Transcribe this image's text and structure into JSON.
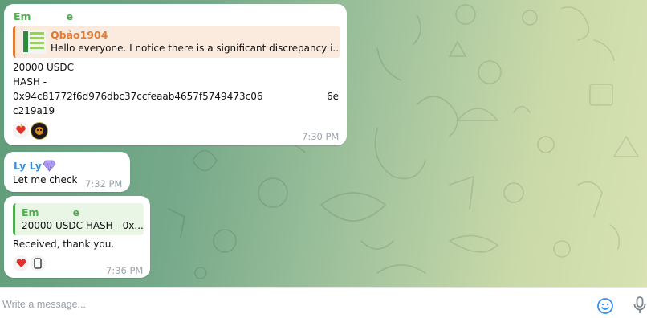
{
  "messages": [
    {
      "sender_prefix": "Em",
      "sender_suffix": "e",
      "reply": {
        "author": "Qbảo1904",
        "text": "Hello everyone. I notice there is a significant discrepancy i..."
      },
      "lines": [
        "20000 USDC",
        "HASH -",
        "0x94c81772f6d976dbc37ccfeaab4657f5749473c06",
        "c219a19"
      ],
      "line_end": "6e",
      "reactions": [
        "heart-fire-icon",
        "tiger-sticker-icon"
      ],
      "time": "7:30 PM"
    },
    {
      "sender": "Ly Ly",
      "sender_icon": "diamond-icon",
      "text": "Let me check",
      "time": "7:32 PM"
    },
    {
      "reply": {
        "author_prefix": "Em",
        "author_suffix": "e",
        "text": "20000 USDC HASH - 0x..."
      },
      "text": "Received, thank you.",
      "reactions": [
        "heart-icon",
        "phone-avatar-icon"
      ],
      "time": "7:36 PM"
    }
  ],
  "input": {
    "placeholder": "Write a message...",
    "emoji_icon": "smile-icon",
    "mic_icon": "microphone-icon"
  },
  "colors": {
    "sender_green": "#4fae4e",
    "reply_orange": "#e17b34",
    "sender_blue": "#3b8fd6",
    "accent": "#3390ec"
  }
}
